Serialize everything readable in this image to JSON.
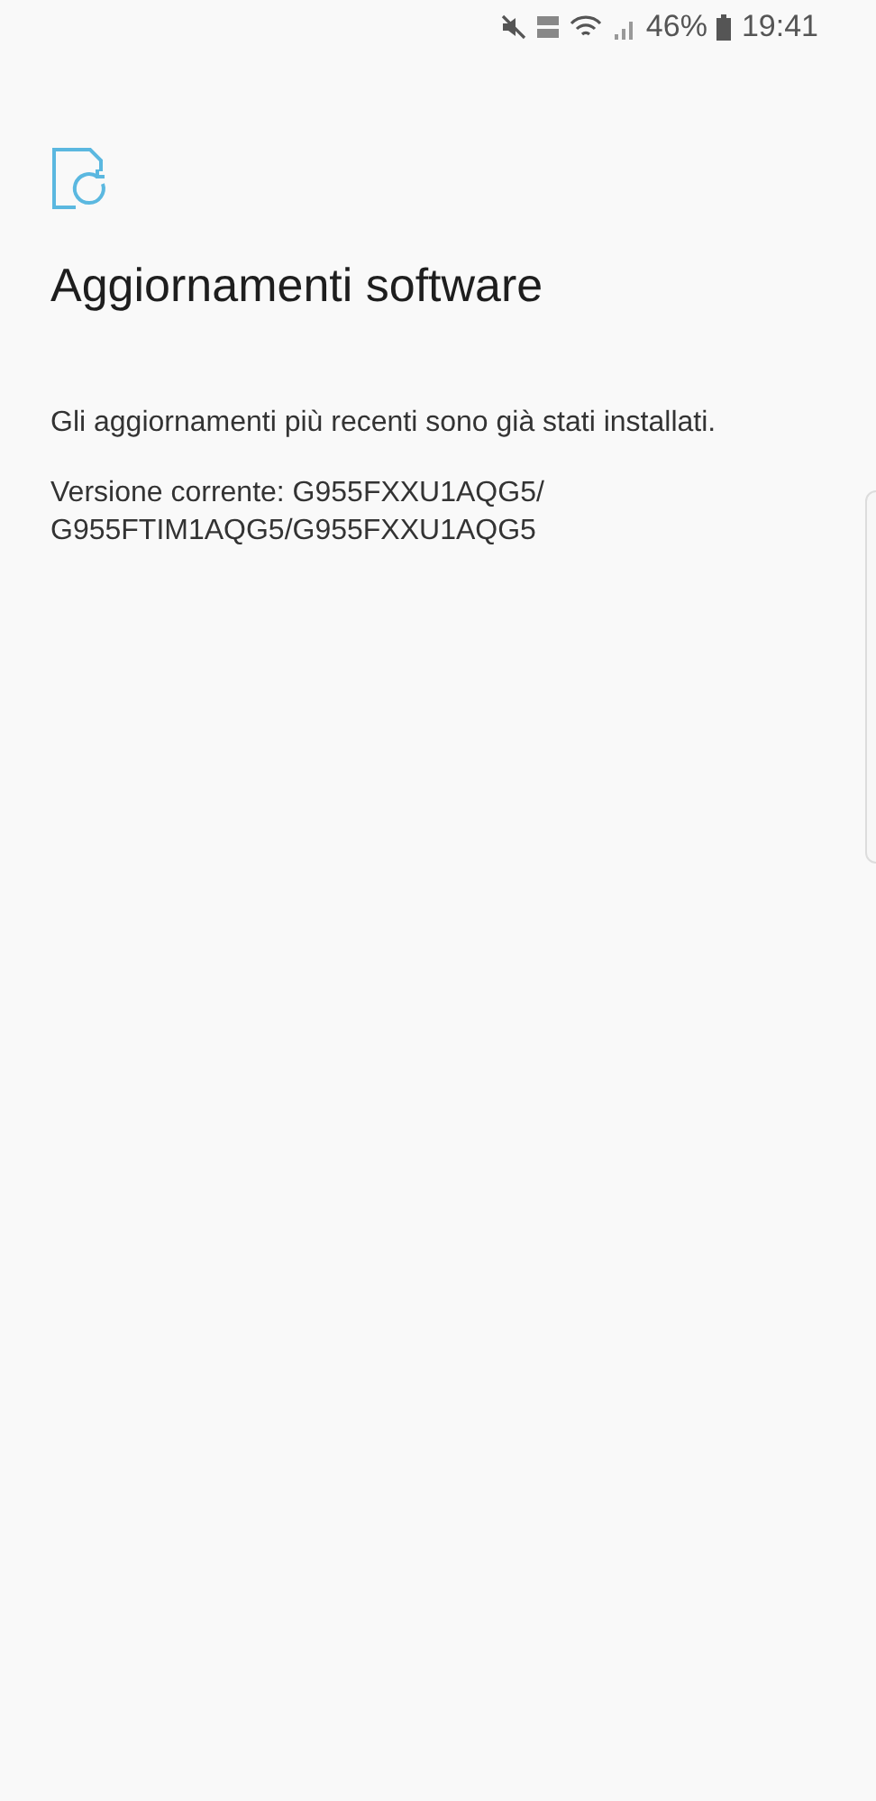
{
  "status_bar": {
    "battery": "46%",
    "time": "19:41"
  },
  "header": {
    "title": "Aggiornamenti software"
  },
  "body": {
    "message": "Gli aggiornamenti più recenti sono già stati installati.",
    "version": "Versione corrente: G955FXXU1AQG5/\nG955FTIM1AQG5/G955FXXU1AQG5"
  }
}
